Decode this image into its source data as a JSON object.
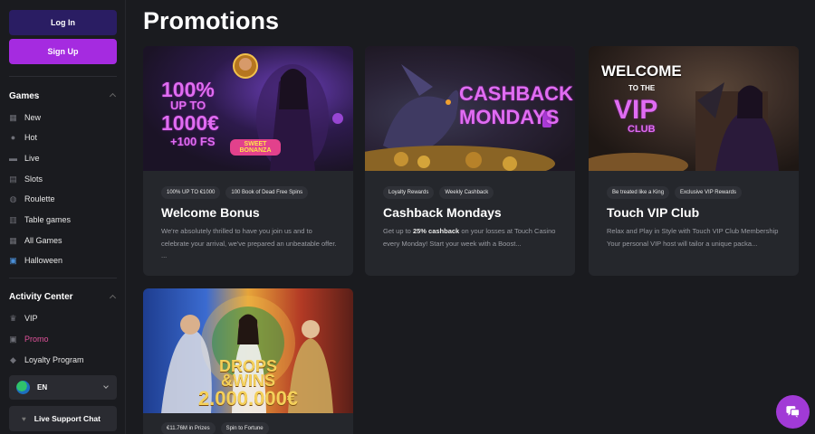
{
  "auth": {
    "login_label": "Log In",
    "signup_label": "Sign Up"
  },
  "sidebar": {
    "games_title": "Games",
    "games_items": [
      {
        "label": "New",
        "icon": "grid-icon"
      },
      {
        "label": "Hot",
        "icon": "flame-icon"
      },
      {
        "label": "Live",
        "icon": "live-icon"
      },
      {
        "label": "Slots",
        "icon": "slots-icon"
      },
      {
        "label": "Roulette",
        "icon": "roulette-icon"
      },
      {
        "label": "Table games",
        "icon": "table-icon"
      },
      {
        "label": "All Games",
        "icon": "all-games-icon"
      },
      {
        "label": "Halloween",
        "icon": "gift-icon"
      }
    ],
    "activity_title": "Activity Center",
    "activity_items": [
      {
        "label": "VIP",
        "icon": "crown-icon"
      },
      {
        "label": "Promo",
        "icon": "promo-icon",
        "active": true
      },
      {
        "label": "Loyalty Program",
        "icon": "diamond-icon"
      }
    ],
    "language": "EN",
    "support_label": "Live Support Chat"
  },
  "page": {
    "title": "Promotions"
  },
  "promotions": [
    {
      "tags": [
        "100% UP TO €1000",
        "100 Book of Dead Free Spins"
      ],
      "title": "Welcome Bonus",
      "description": "We're absolutely thrilled to have you join us and to celebrate your arrival, we've prepared an unbeatable offer. ...",
      "banner_lines": [
        "100%",
        "UP TO",
        "1000€",
        "+100 FS",
        "SWEET BONANZA"
      ]
    },
    {
      "tags": [
        "Loyalty Rewards",
        "Weekly Cashback"
      ],
      "title": "Cashback Mondays",
      "description_pre": "Get up to ",
      "description_bold": "25% cashback",
      "description_post": " on your losses at Touch Casino every Monday! Start your week with a Boost...",
      "banner_lines": [
        "CASHBACK",
        "MONDAYS"
      ]
    },
    {
      "tags": [
        "Be treated like a King",
        "Exclusive VIP Rewards"
      ],
      "title": "Touch VIP Club",
      "description": "Relax and Play in Style with Touch VIP Club Membership",
      "description_line2": "Your personal VIP host will tailor a unique packa...",
      "banner_lines": [
        "WELCOME",
        "TO THE",
        "VIP",
        "CLUB"
      ]
    },
    {
      "tags": [
        "€11.76M in Prizes",
        "Spin to Fortune"
      ],
      "banner_lines": [
        "DROPS",
        "&WINS",
        "2.000.000€"
      ]
    }
  ]
}
